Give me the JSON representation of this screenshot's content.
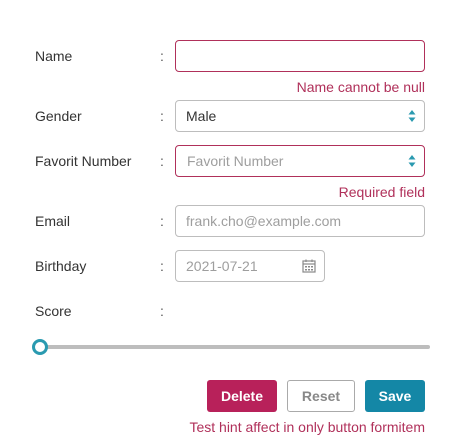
{
  "form": {
    "name": {
      "label": "Name",
      "colon": ":",
      "value": "",
      "error": "Name cannot be null"
    },
    "gender": {
      "label": "Gender",
      "colon": ":",
      "value": "Male"
    },
    "favorite_number": {
      "label": "Favorit Number",
      "colon": ":",
      "placeholder": "Favorit Number",
      "error": "Required field"
    },
    "email": {
      "label": "Email",
      "colon": ":",
      "placeholder": "frank.cho@example.com"
    },
    "birthday": {
      "label": "Birthday",
      "colon": ":",
      "placeholder": "2021-07-21"
    },
    "score": {
      "label": "Score",
      "colon": ":",
      "value": 0
    }
  },
  "buttons": {
    "delete": "Delete",
    "reset": "Reset",
    "save": "Save"
  },
  "button_hint": "Test hint affect in only button formitem",
  "colors": {
    "error": "#b0305a",
    "accent": "#2a9ab0",
    "delete": "#b8215a",
    "save": "#1487a6"
  }
}
